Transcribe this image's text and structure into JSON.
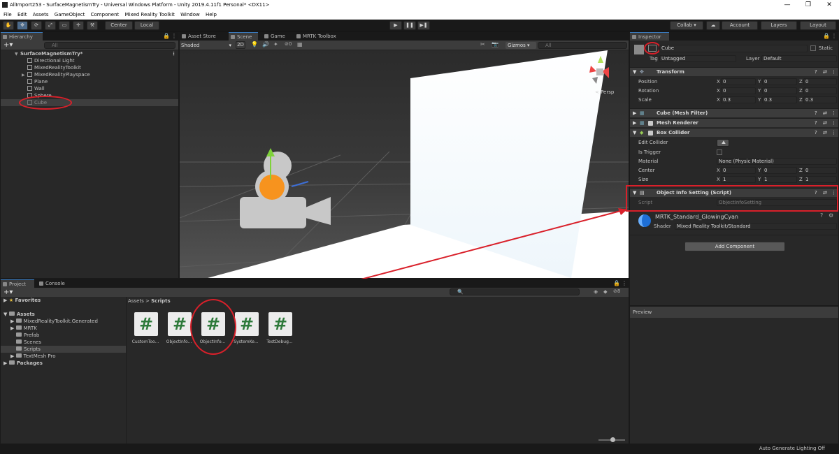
{
  "window": {
    "title": "AllImport253 - SurfaceMagnetismTry - Universal Windows Platform - Unity 2019.4.11f1 Personal* <DX11>",
    "controls": [
      "—",
      "❐",
      "✕"
    ]
  },
  "menu": [
    "File",
    "Edit",
    "Assets",
    "GameObject",
    "Component",
    "Mixed Reality Toolkit",
    "Window",
    "Help"
  ],
  "toolbar": {
    "pivot_center": "Center",
    "pivot_local": "Local",
    "collab": "Collab ▾",
    "account": "Account",
    "layers": "Layers",
    "layout": "Layout"
  },
  "hierarchy": {
    "tab": "Hierarchy",
    "search_placeholder": "All",
    "scene": "SurfaceMagnetismTry*",
    "items": [
      "Directional Light",
      "MixedRealityToolkit",
      "MixedRealityPlayspace",
      "Plane",
      "Wall",
      "Sphere",
      "Cube"
    ]
  },
  "scene_view": {
    "tabs": [
      "Asset Store",
      "Scene",
      "Game",
      "MRTK Toolbox"
    ],
    "shading": "Shaded",
    "mode_2d": "2D",
    "hidden_count": "0",
    "gizmos": "Gizmos",
    "search_placeholder": "All",
    "persp": "< Persp"
  },
  "project": {
    "tabs": [
      "Project",
      "Console"
    ],
    "favorites": "Favorites",
    "assets": "Assets",
    "folders": [
      "MixedRealityToolkit.Generated",
      "MRTK",
      "Prefab",
      "Scenes",
      "Scripts",
      "TextMesh Pro"
    ],
    "packages": "Packages",
    "breadcrumb_root": "Assets",
    "breadcrumb_sep": ">",
    "breadcrumb_current": "Scripts",
    "hidden_count": "8",
    "files": [
      "CustomToo...",
      "ObjectInfo...",
      "ObjectInfo...",
      "SystemKe...",
      "TestDebug..."
    ]
  },
  "inspector": {
    "tab": "Inspector",
    "object_name": "Cube",
    "static_label": "Static",
    "tag_label": "Tag",
    "tag_value": "Untagged",
    "layer_label": "Layer",
    "layer_value": "Default",
    "transform": {
      "title": "Transform",
      "rows": [
        {
          "label": "Position",
          "x": "0",
          "y": "0",
          "z": "0"
        },
        {
          "label": "Rotation",
          "x": "0",
          "y": "0",
          "z": "0"
        },
        {
          "label": "Scale",
          "x": "0.3",
          "y": "0.3",
          "z": "0.3"
        }
      ]
    },
    "mesh_filter": "Cube (Mesh Filter)",
    "mesh_renderer": "Mesh Renderer",
    "box_collider": {
      "title": "Box Collider",
      "edit_collider": "Edit Collider",
      "is_trigger": "Is Trigger",
      "material_label": "Material",
      "material_value": "None (Physic Material)",
      "center_label": "Center",
      "center": {
        "x": "0",
        "y": "0",
        "z": "0"
      },
      "size_label": "Size",
      "size": {
        "x": "1",
        "y": "1",
        "z": "1"
      }
    },
    "script_component": {
      "title": "Object Info Setting (Script)",
      "script_label": "Script",
      "script_value": "ObjectInfoSetting"
    },
    "material": {
      "name": "MRTK_Standard_GlowingCyan",
      "shader_label": "Shader",
      "shader_value": "Mixed Reality Toolkit/Standard"
    },
    "add_component": "Add Component",
    "preview": "Preview"
  },
  "statusbar": {
    "text": "Auto Generate Lighting Off"
  }
}
